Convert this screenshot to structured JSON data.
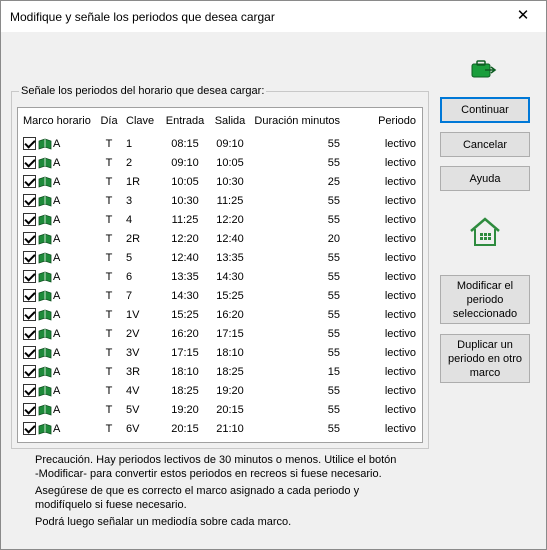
{
  "window": {
    "title": "Modifique y señale los periodos que desea cargar",
    "close_glyph": "✕"
  },
  "group": {
    "label": "Señale los periodos del horario que desea cargar:"
  },
  "table": {
    "headers": [
      "Marco horario",
      "Día",
      "Clave",
      "Entrada",
      "Salida",
      "Duración minutos",
      "Periodo"
    ],
    "rows": [
      {
        "checked": true,
        "marco": "A",
        "dia": "T",
        "clave": "1",
        "entrada": "08:15",
        "salida": "09:10",
        "duracion": "55",
        "periodo": "lectivo"
      },
      {
        "checked": true,
        "marco": "A",
        "dia": "T",
        "clave": "2",
        "entrada": "09:10",
        "salida": "10:05",
        "duracion": "55",
        "periodo": "lectivo"
      },
      {
        "checked": true,
        "marco": "A",
        "dia": "T",
        "clave": "1R",
        "entrada": "10:05",
        "salida": "10:30",
        "duracion": "25",
        "periodo": "lectivo"
      },
      {
        "checked": true,
        "marco": "A",
        "dia": "T",
        "clave": "3",
        "entrada": "10:30",
        "salida": "11:25",
        "duracion": "55",
        "periodo": "lectivo"
      },
      {
        "checked": true,
        "marco": "A",
        "dia": "T",
        "clave": "4",
        "entrada": "11:25",
        "salida": "12:20",
        "duracion": "55",
        "periodo": "lectivo"
      },
      {
        "checked": true,
        "marco": "A",
        "dia": "T",
        "clave": "2R",
        "entrada": "12:20",
        "salida": "12:40",
        "duracion": "20",
        "periodo": "lectivo"
      },
      {
        "checked": true,
        "marco": "A",
        "dia": "T",
        "clave": "5",
        "entrada": "12:40",
        "salida": "13:35",
        "duracion": "55",
        "periodo": "lectivo"
      },
      {
        "checked": true,
        "marco": "A",
        "dia": "T",
        "clave": "6",
        "entrada": "13:35",
        "salida": "14:30",
        "duracion": "55",
        "periodo": "lectivo"
      },
      {
        "checked": true,
        "marco": "A",
        "dia": "T",
        "clave": "7",
        "entrada": "14:30",
        "salida": "15:25",
        "duracion": "55",
        "periodo": "lectivo"
      },
      {
        "checked": true,
        "marco": "A",
        "dia": "T",
        "clave": "1V",
        "entrada": "15:25",
        "salida": "16:20",
        "duracion": "55",
        "periodo": "lectivo"
      },
      {
        "checked": true,
        "marco": "A",
        "dia": "T",
        "clave": "2V",
        "entrada": "16:20",
        "salida": "17:15",
        "duracion": "55",
        "periodo": "lectivo"
      },
      {
        "checked": true,
        "marco": "A",
        "dia": "T",
        "clave": "3V",
        "entrada": "17:15",
        "salida": "18:10",
        "duracion": "55",
        "periodo": "lectivo"
      },
      {
        "checked": true,
        "marco": "A",
        "dia": "T",
        "clave": "3R",
        "entrada": "18:10",
        "salida": "18:25",
        "duracion": "15",
        "periodo": "lectivo"
      },
      {
        "checked": true,
        "marco": "A",
        "dia": "T",
        "clave": "4V",
        "entrada": "18:25",
        "salida": "19:20",
        "duracion": "55",
        "periodo": "lectivo"
      },
      {
        "checked": true,
        "marco": "A",
        "dia": "T",
        "clave": "5V",
        "entrada": "19:20",
        "salida": "20:15",
        "duracion": "55",
        "periodo": "lectivo"
      },
      {
        "checked": true,
        "marco": "A",
        "dia": "T",
        "clave": "6V",
        "entrada": "20:15",
        "salida": "21:10",
        "duracion": "55",
        "periodo": "lectivo"
      }
    ]
  },
  "buttons": {
    "continuar": "Continuar",
    "cancelar": "Cancelar",
    "ayuda": "Ayuda",
    "modificar": [
      "Modificar el",
      "periodo",
      "seleccionado"
    ],
    "duplicar": [
      "Duplicar un",
      "periodo en otro",
      "marco"
    ]
  },
  "icons": {
    "top_right": "briefcase-arrow-icon",
    "home": "home-icon",
    "row_book": "book-icon",
    "book_color": "#1e8a3a",
    "briefcase_color": "#1a9e3c",
    "home_color": "#2e8b3e"
  },
  "notes": {
    "line1": "Precaución.  Hay periodos lectivos de 30 minutos o menos.  Utilice el botón",
    "line2": "-Modificar- para convertir estos periodos en recreos si fuese necesario.",
    "line3": "Asegúrese de que es correcto el marco asignado a cada periodo y",
    "line4": "modifíquelo si fuese necesario.",
    "line5": "Podrá luego señalar un mediodía sobre cada marco."
  },
  "colors": {
    "accent": "#0078d7",
    "button_bg": "#e1e1e1",
    "window_bg": "#f0f0f0"
  }
}
